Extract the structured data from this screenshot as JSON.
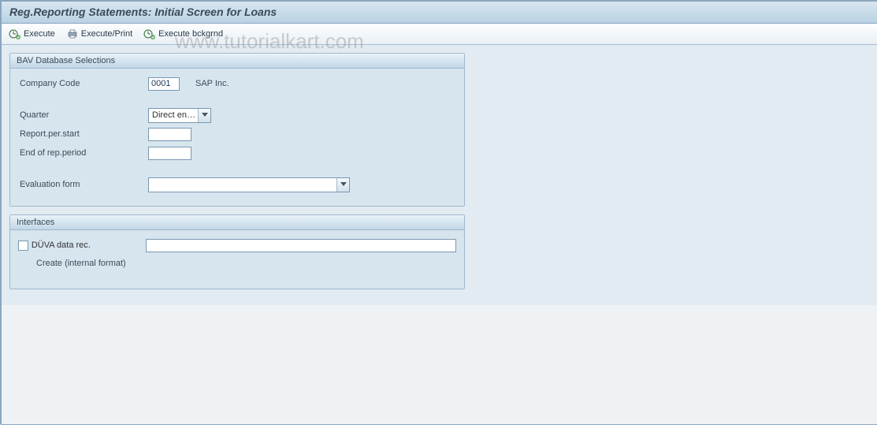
{
  "title": "Reg.Reporting Statements: Initial Screen for Loans",
  "toolbar": {
    "execute": "Execute",
    "execute_print": "Execute/Print",
    "execute_bckgrnd": "Execute bckgrnd"
  },
  "group_bav": {
    "header": "BAV Database Selections",
    "company_code_label": "Company Code",
    "company_code_value": "0001",
    "company_name": "SAP Inc.",
    "quarter_label": "Quarter",
    "quarter_value": "Direct en…",
    "report_start_label": "Report.per.start",
    "report_start_value": "",
    "report_end_label": "End of rep.period",
    "report_end_value": "",
    "eval_form_label": "Evaluation form",
    "eval_form_value": ""
  },
  "group_if": {
    "header": "Interfaces",
    "duva_label": "DÜVA data rec.",
    "duva_value": "",
    "create_label": "Create (internal format)"
  },
  "watermark": "www.tutorialkart.com"
}
